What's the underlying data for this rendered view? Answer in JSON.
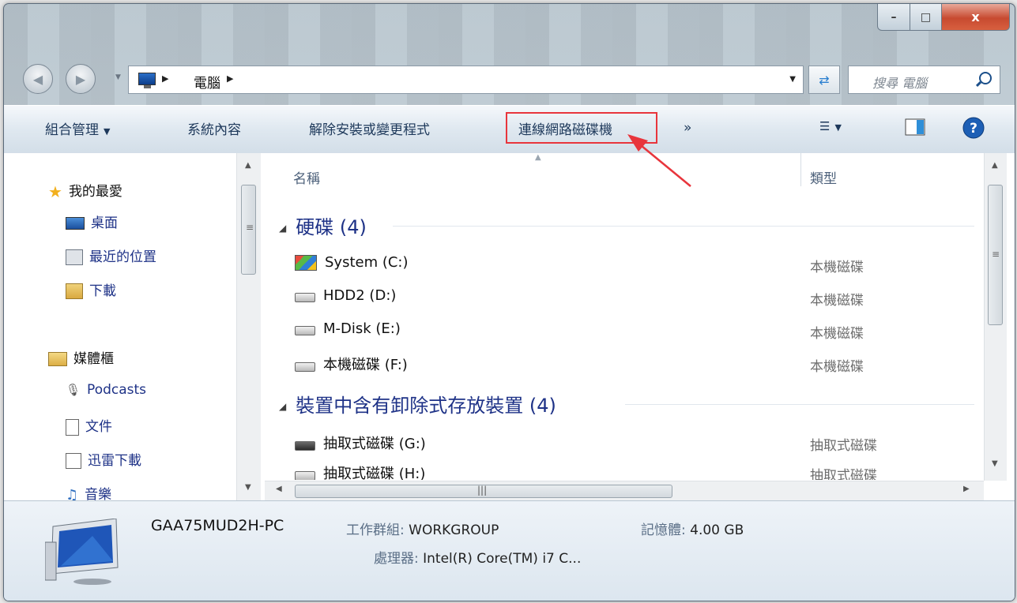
{
  "window": {
    "caption_buttons": {
      "minimize": "–",
      "maximize": "□",
      "close": "x"
    }
  },
  "address_bar": {
    "crumbs": [
      "電腦"
    ],
    "search_placeholder": "搜尋 電腦"
  },
  "toolbar": {
    "organize": "組合管理",
    "system_properties": "系統內容",
    "uninstall": "解除安裝或變更程式",
    "map_network_drive": "連線網路磁碟機",
    "more": "»"
  },
  "nav_pane": {
    "favorites_header": "我的最愛",
    "favorites": [
      "桌面",
      "最近的位置",
      "下載"
    ],
    "libraries_header": "媒體櫃",
    "libraries": [
      "Podcasts",
      "文件",
      "迅雷下載",
      "音樂"
    ]
  },
  "columns": {
    "name": "名稱",
    "type": "類型"
  },
  "groups": [
    {
      "title": "硬碟 (4)",
      "items": [
        {
          "name": "System (C:)",
          "type": "本機磁碟"
        },
        {
          "name": "HDD2 (D:)",
          "type": "本機磁碟"
        },
        {
          "name": "M-Disk (E:)",
          "type": "本機磁碟"
        },
        {
          "name": "本機磁碟 (F:)",
          "type": "本機磁碟"
        }
      ]
    },
    {
      "title": "裝置中含有卸除式存放裝置 (4)",
      "items": [
        {
          "name": "抽取式磁碟 (G:)",
          "type": "抽取式磁碟"
        },
        {
          "name": "抽取式磁碟 (H:)",
          "type": "抽取式磁碟"
        }
      ]
    }
  ],
  "details": {
    "computer_name": "GAA75MUD2H-PC",
    "workgroup_label": "工作群組:",
    "workgroup_value": "WORKGROUP",
    "memory_label": "記憶體:",
    "memory_value": "4.00 GB",
    "cpu_label": "處理器:",
    "cpu_value": "Intel(R) Core(TM) i7 C..."
  },
  "colors": {
    "highlight_box": "#e8353c",
    "link_text": "#1e3287"
  }
}
